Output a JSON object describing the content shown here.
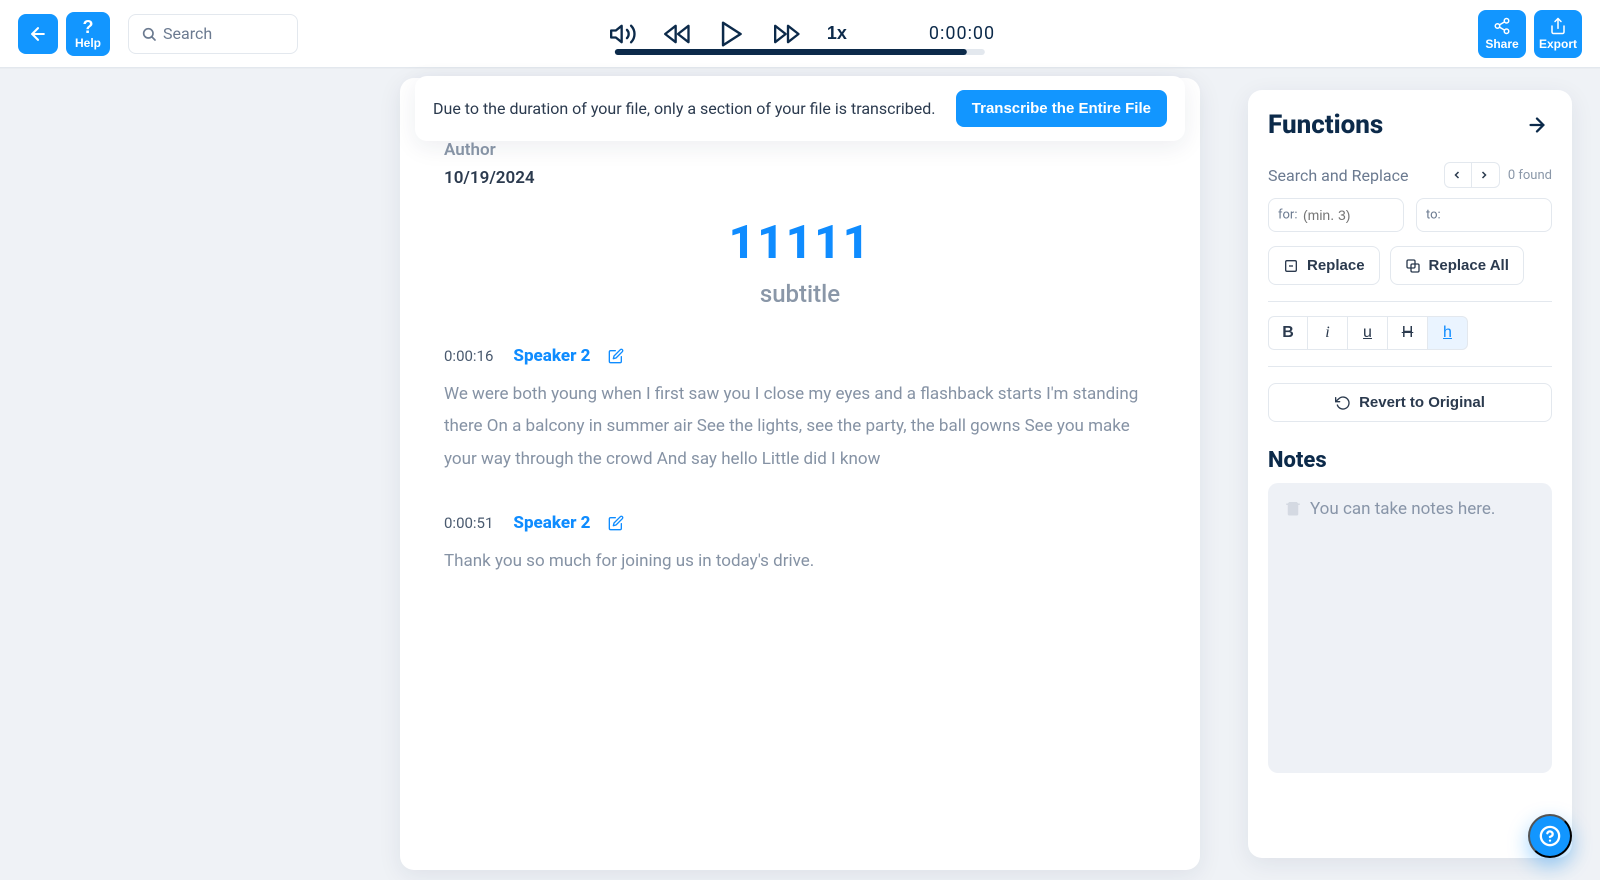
{
  "header": {
    "search_placeholder": "Search",
    "help_label": "Help",
    "share_label": "Share",
    "export_label": "Export",
    "speed_label": "1x",
    "timecode": "0:00:00",
    "progress_percent": 95
  },
  "banner": {
    "text": "Due to the duration of your file, only a section of your file is transcribed.",
    "button": "Transcribe the Entire File"
  },
  "document": {
    "author_label": "Author",
    "author_date": "10/19/2024",
    "title": "11111",
    "subtitle": "subtitle",
    "segments": [
      {
        "time": "0:00:16",
        "speaker": "Speaker 2",
        "text": "We were both young when I first saw you I close my eyes and a flashback starts I'm standing there On a balcony in summer air See the lights, see the party, the ball gowns See you make your way through the crowd And say hello Little did I know"
      },
      {
        "time": "0:00:51",
        "speaker": "Speaker 2",
        "text": "Thank you so much for joining us in today's drive."
      }
    ]
  },
  "panel": {
    "title": "Functions",
    "search_replace_label": "Search and Replace",
    "found_label": "0 found",
    "for_prefix": "for:",
    "for_placeholder": "(min. 3)",
    "to_prefix": "to:",
    "replace_label": "Replace",
    "replace_all_label": "Replace All",
    "revert_label": "Revert to Original",
    "notes_title": "Notes",
    "notes_placeholder": "You can take notes here.",
    "format": {
      "bold": "B",
      "italic": "i",
      "underline": "u",
      "strike": "H",
      "highlight": "h"
    }
  }
}
